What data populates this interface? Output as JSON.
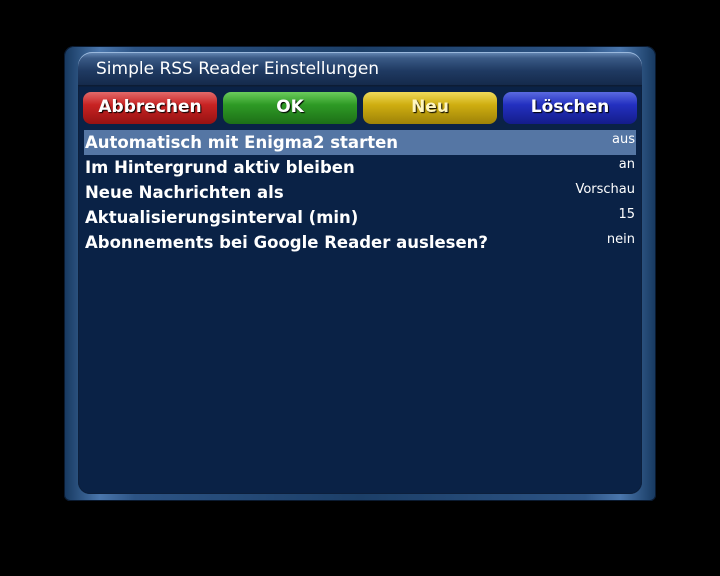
{
  "window": {
    "title": "Simple RSS Reader Einstellungen"
  },
  "buttons": {
    "red": "Abbrechen",
    "green": "OK",
    "yellow": "Neu",
    "blue": "Löschen"
  },
  "settings": [
    {
      "label": "Automatisch mit Enigma2 starten",
      "value": "aus"
    },
    {
      "label": "Im Hintergrund aktiv bleiben",
      "value": "an"
    },
    {
      "label": "Neue Nachrichten als",
      "value": "Vorschau"
    },
    {
      "label": "Aktualisierungsinterval (min)",
      "value": "15"
    },
    {
      "label": "Abonnements bei Google Reader auslesen?",
      "value": "nein"
    }
  ],
  "colors": {
    "background": "#000000",
    "panel": "#0a2246",
    "selection": "#5576a4",
    "red": "#c82323",
    "green": "#2e9a25",
    "yellow": "#cfae10",
    "blue": "#2330c0"
  }
}
